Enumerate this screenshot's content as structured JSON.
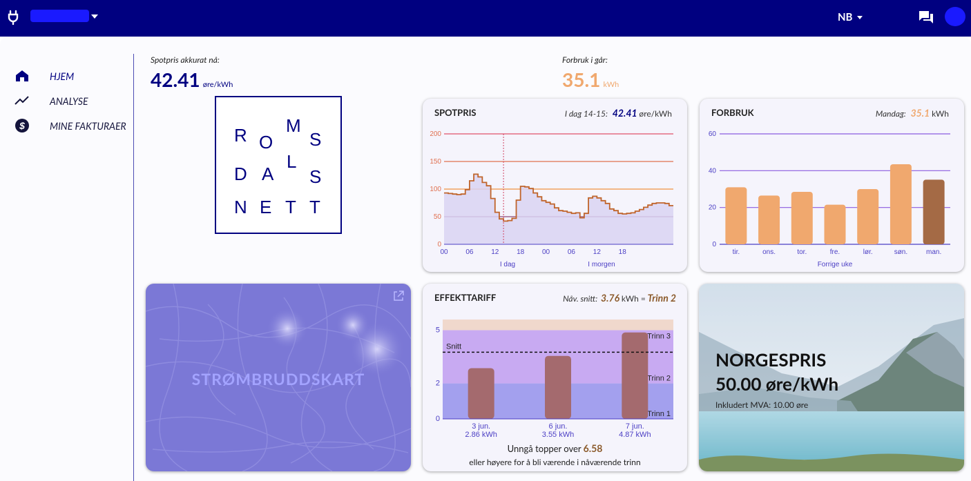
{
  "header": {
    "language": "NB",
    "brand_color": "#000080"
  },
  "nav": [
    {
      "label": "HJEM",
      "icon": "home-icon"
    },
    {
      "label": "ANALYSE",
      "icon": "trend-icon"
    },
    {
      "label": "MINE FAKTURAER",
      "icon": "dollar-icon"
    }
  ],
  "spot_now": {
    "label": "Spotpris akkurat nå:",
    "value": "42.41",
    "unit": "øre/kWh"
  },
  "yesterday": {
    "label": "Forbruk i går:",
    "value": "35.1",
    "unit": "kWh"
  },
  "logo_letters": [
    "R",
    "O",
    "M",
    "S",
    "D",
    "A",
    "L",
    "S",
    "N",
    "E",
    "T",
    "T"
  ],
  "spot_card": {
    "title": "SPOTPRIS",
    "right_label": "I dag 14-15:",
    "right_value": "42.41",
    "right_unit": "øre/kWh",
    "xlabel_today": "I dag",
    "xlabel_tomorrow": "I morgen"
  },
  "usage_card": {
    "title": "FORBRUK",
    "right_label": "Mandag:",
    "right_value": "35.1",
    "right_unit": "kWh",
    "xlabel": "Forrige uke"
  },
  "tariff_card": {
    "title": "EFFEKTTARIFF",
    "right_label": "Nåv. snitt:",
    "right_value": "3.76",
    "right_unit": "kWh =",
    "right_level": "Trinn 2",
    "avoid_prefix": "Unngå topper over",
    "avoid_value": "6.58",
    "avoid_suffix": "eller høyere for å bli værende i nåværende trinn"
  },
  "map_card": {
    "title": "STRØMBRUDDSKART"
  },
  "norge_card": {
    "line1": "NORGESPRIS",
    "line2": "50.00 øre/kWh",
    "line3": "Inkludert MVA: 10.00 øre"
  },
  "chart_data": [
    {
      "type": "line",
      "title": "SPOTPRIS",
      "x_ticks": [
        "00",
        "06",
        "12",
        "18",
        "00",
        "06",
        "12",
        "18"
      ],
      "ylim": [
        0,
        200
      ],
      "y_ticks": [
        0,
        50,
        100,
        150,
        200
      ],
      "reference_lines": [
        200,
        150,
        100,
        50
      ],
      "current_hour_marker": 14,
      "values": [
        93,
        92,
        91,
        90,
        91,
        99,
        115,
        127,
        122,
        112,
        106,
        83,
        58,
        46,
        42,
        43,
        47,
        80,
        105,
        104,
        101,
        93,
        86,
        79,
        76,
        73,
        66,
        61,
        60,
        58,
        56,
        57,
        48,
        56,
        84,
        87,
        84,
        79,
        74,
        64,
        61,
        56,
        55,
        56,
        57,
        60,
        63,
        67,
        71,
        74,
        75,
        75,
        74,
        70
      ]
    },
    {
      "type": "bar",
      "title": "FORBRUK",
      "categories": [
        "tir.",
        "ons.",
        "tor.",
        "fre.",
        "lør.",
        "søn.",
        "man."
      ],
      "values": [
        31,
        26.5,
        28.5,
        21.5,
        30,
        43.5,
        35.1
      ],
      "ylim": [
        0,
        60
      ],
      "y_ticks": [
        0,
        20,
        40,
        60
      ]
    },
    {
      "type": "bar",
      "title": "EFFEKTTARIFF",
      "categories": [
        "3 jun.",
        "6 jun.",
        "7 jun."
      ],
      "value_labels": [
        "2.86 kWh",
        "3.55 kWh",
        "4.87 kWh"
      ],
      "values": [
        2.86,
        3.55,
        4.87
      ],
      "average": 3.76,
      "average_label": "Snitt",
      "ylim": [
        0,
        5.6
      ],
      "y_ticks": [
        0,
        2,
        5
      ],
      "levels": [
        {
          "name": "Trinn 1",
          "from": 0,
          "to": 2
        },
        {
          "name": "Trinn 2",
          "from": 2,
          "to": 5
        },
        {
          "name": "Trinn 3",
          "from": 5,
          "to": 5.6
        }
      ]
    }
  ]
}
